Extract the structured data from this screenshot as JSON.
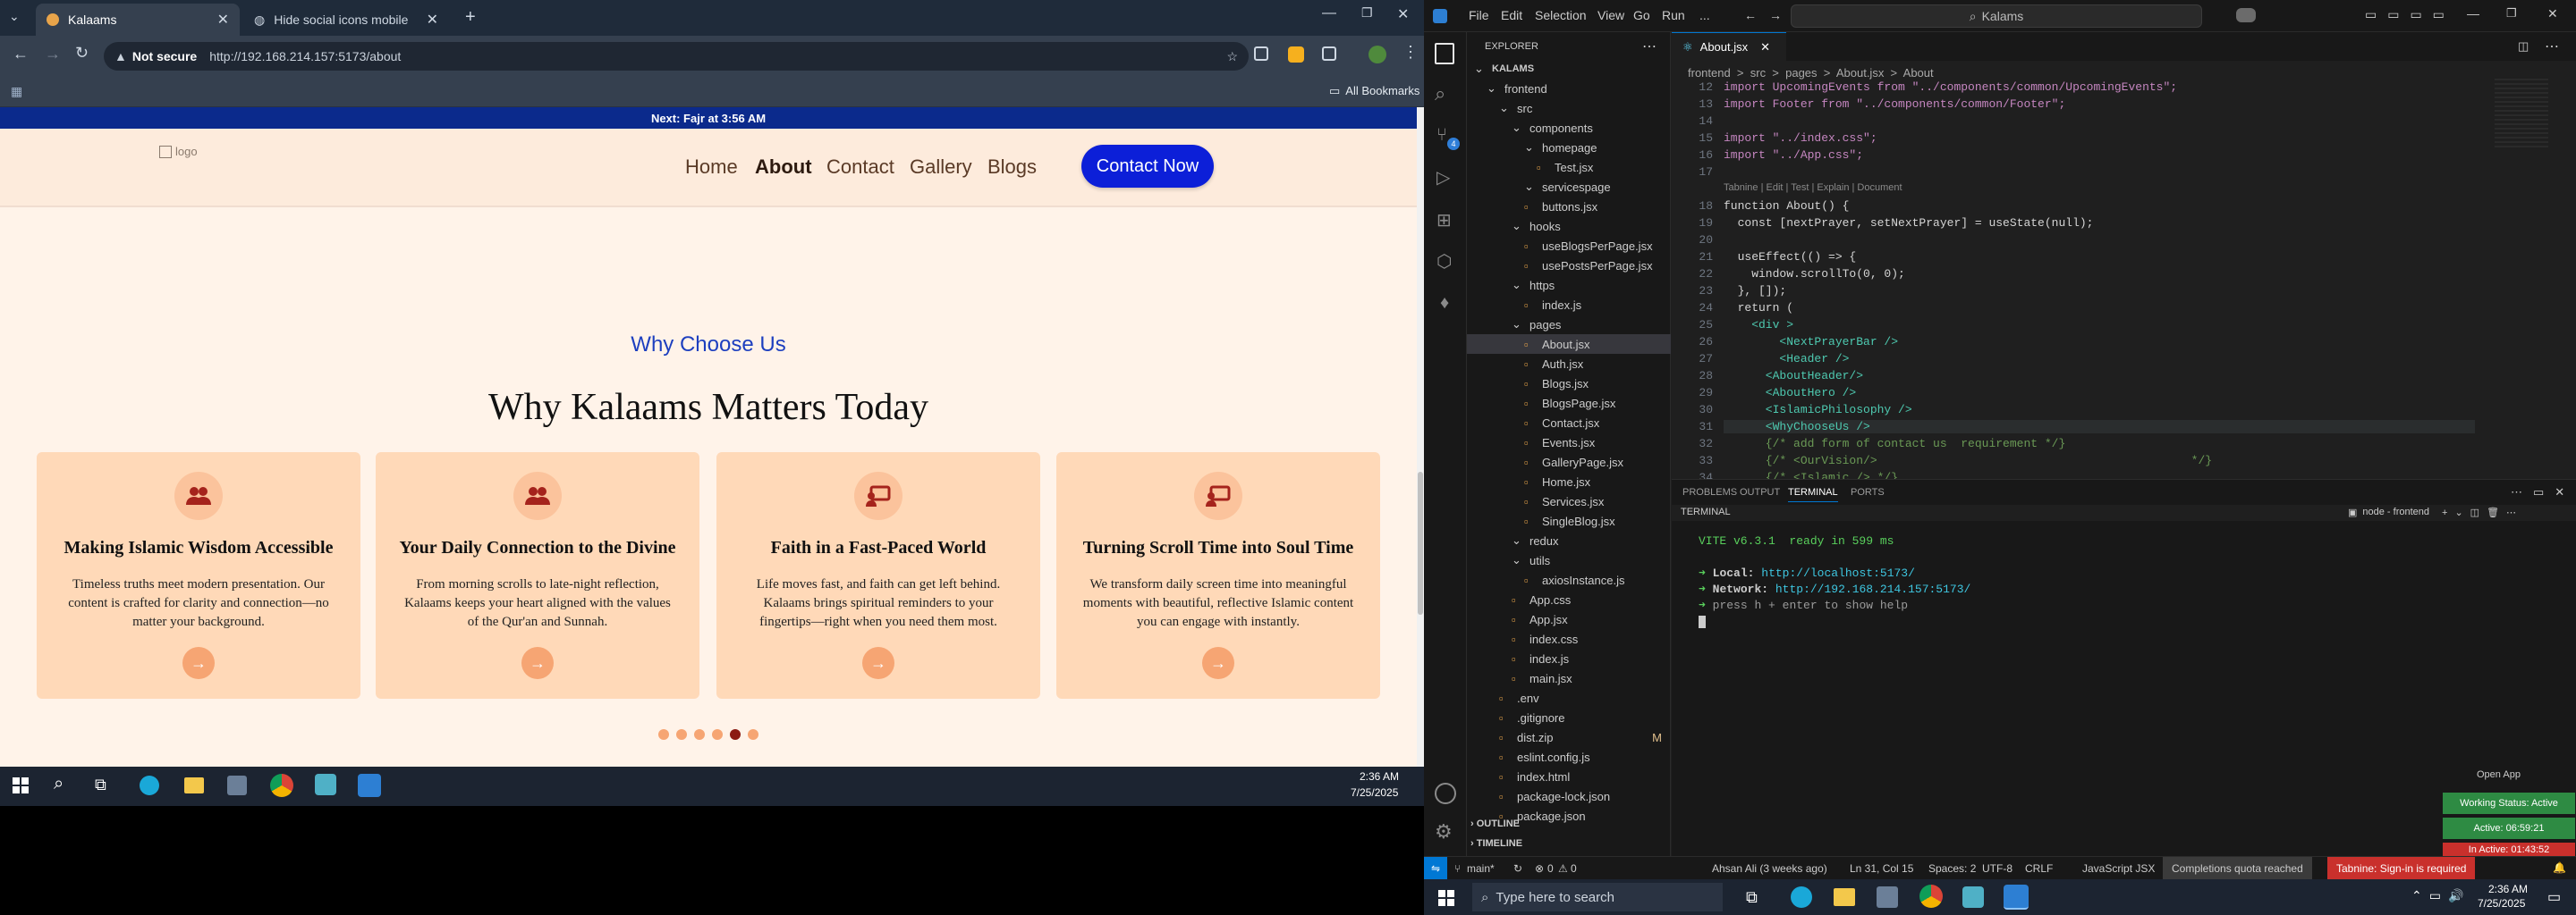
{
  "browser": {
    "tabs": [
      {
        "label": "Kalaams",
        "active": true
      },
      {
        "label": "Hide social icons mobile",
        "active": false
      }
    ],
    "security_label": "Not secure",
    "url": "http://192.168.214.157:5173/about",
    "all_bookmarks": "All Bookmarks"
  },
  "site": {
    "prayer_bar": "Next: Fajr at 3:56 AM",
    "logo_alt": "logo",
    "nav": [
      "Home",
      "About",
      "Contact",
      "Gallery",
      "Blogs"
    ],
    "contact_button": "Contact Now",
    "section_kicker": "Why Choose Us",
    "section_title": "Why Kalaams Matters Today",
    "cards": [
      {
        "title": "Making Islamic Wisdom Accessible",
        "text": "Timeless truths meet modern presentation. Our content is crafted for clarity and connection—no matter your background.",
        "icon": "users-icon"
      },
      {
        "title": "Your Daily Connection to the Divine",
        "text": "From morning scrolls to late-night reflection, Kalaams keeps your heart aligned with the values of the Qur'an and Sunnah.",
        "icon": "users-icon"
      },
      {
        "title": "Faith in a Fast-Paced World",
        "text": "Life moves fast, and faith can get left behind. Kalaams brings spiritual reminders to your fingertips—right when you need them most.",
        "icon": "presentation-icon"
      },
      {
        "title": "Turning Scroll Time into Soul Time",
        "text": "We transform daily screen time into meaningful moments with beautiful, reflective Islamic content you can engage with instantly.",
        "icon": "presentation-icon"
      }
    ],
    "carousel_dots": 6,
    "carousel_active": 4,
    "accent": "#0c1fd8",
    "card_bg": "#ffd9b8"
  },
  "taskbar_left": {
    "time": "2:36 AM",
    "date": "7/25/2025"
  },
  "vscode": {
    "menu": [
      "File",
      "Edit",
      "Selection",
      "View",
      "Go",
      "Run",
      "..."
    ],
    "search": "Kalams",
    "editor_tab": "About.jsx",
    "explorer_title": "EXPLORER",
    "breadcrumb": "frontend  >  src  >  pages  >  About.jsx  >  About",
    "explorer": [
      {
        "label": "KALAMS",
        "indent": 0,
        "kind": "root"
      },
      {
        "label": "frontend",
        "indent": 1,
        "kind": "folder"
      },
      {
        "label": "src",
        "indent": 2,
        "kind": "folder"
      },
      {
        "label": "components",
        "indent": 3,
        "kind": "folder"
      },
      {
        "label": "homepage",
        "indent": 4,
        "kind": "folder"
      },
      {
        "label": "Test.jsx",
        "indent": 5,
        "kind": "file"
      },
      {
        "label": "servicespage",
        "indent": 4,
        "kind": "folder"
      },
      {
        "label": "buttons.jsx",
        "indent": 4,
        "kind": "file"
      },
      {
        "label": "hooks",
        "indent": 3,
        "kind": "folder"
      },
      {
        "label": "useBlogsPerPage.jsx",
        "indent": 4,
        "kind": "file"
      },
      {
        "label": "usePostsPerPage.jsx",
        "indent": 4,
        "kind": "file"
      },
      {
        "label": "https",
        "indent": 3,
        "kind": "folder"
      },
      {
        "label": "index.js",
        "indent": 4,
        "kind": "file"
      },
      {
        "label": "pages",
        "indent": 3,
        "kind": "folder"
      },
      {
        "label": "About.jsx",
        "indent": 4,
        "kind": "file",
        "selected": true
      },
      {
        "label": "Auth.jsx",
        "indent": 4,
        "kind": "file"
      },
      {
        "label": "Blogs.jsx",
        "indent": 4,
        "kind": "file"
      },
      {
        "label": "BlogsPage.jsx",
        "indent": 4,
        "kind": "file"
      },
      {
        "label": "Contact.jsx",
        "indent": 4,
        "kind": "file"
      },
      {
        "label": "Events.jsx",
        "indent": 4,
        "kind": "file"
      },
      {
        "label": "GalleryPage.jsx",
        "indent": 4,
        "kind": "file"
      },
      {
        "label": "Home.jsx",
        "indent": 4,
        "kind": "file"
      },
      {
        "label": "Services.jsx",
        "indent": 4,
        "kind": "file"
      },
      {
        "label": "SingleBlog.jsx",
        "indent": 4,
        "kind": "file"
      },
      {
        "label": "redux",
        "indent": 3,
        "kind": "folder"
      },
      {
        "label": "utils",
        "indent": 3,
        "kind": "folder"
      },
      {
        "label": "axiosInstance.js",
        "indent": 4,
        "kind": "file"
      },
      {
        "label": "App.css",
        "indent": 3,
        "kind": "file"
      },
      {
        "label": "App.jsx",
        "indent": 3,
        "kind": "file"
      },
      {
        "label": "index.css",
        "indent": 3,
        "kind": "file"
      },
      {
        "label": "index.js",
        "indent": 3,
        "kind": "file"
      },
      {
        "label": "main.jsx",
        "indent": 3,
        "kind": "file"
      },
      {
        "label": ".env",
        "indent": 2,
        "kind": "file"
      },
      {
        "label": ".gitignore",
        "indent": 2,
        "kind": "file"
      },
      {
        "label": "dist.zip",
        "indent": 2,
        "kind": "file",
        "badge": "M"
      },
      {
        "label": "eslint.config.js",
        "indent": 2,
        "kind": "file"
      },
      {
        "label": "index.html",
        "indent": 2,
        "kind": "file"
      },
      {
        "label": "package-lock.json",
        "indent": 2,
        "kind": "file"
      },
      {
        "label": "package.json",
        "indent": 2,
        "kind": "file"
      }
    ],
    "outline": "OUTLINE",
    "timeline": "TIMELINE",
    "code": [
      {
        "n": "12",
        "t": "import UpcomingEvents from \"../components/common/UpcomingEvents\";"
      },
      {
        "n": "13",
        "t": "import Footer from \"../components/common/Footer\";"
      },
      {
        "n": "14",
        "t": ""
      },
      {
        "n": "15",
        "t": "import \"../index.css\";"
      },
      {
        "n": "16",
        "t": "import \"../App.css\";"
      },
      {
        "n": "17",
        "t": ""
      },
      {
        "n": "",
        "t": "Tabnine | Edit | Test | Explain | Document"
      },
      {
        "n": "18",
        "t": "function About() {"
      },
      {
        "n": "19",
        "t": "  const [nextPrayer, setNextPrayer] = useState(null);"
      },
      {
        "n": "20",
        "t": ""
      },
      {
        "n": "21",
        "t": "  useEffect(() => {"
      },
      {
        "n": "22",
        "t": "    window.scrollTo(0, 0);"
      },
      {
        "n": "23",
        "t": "  }, []);"
      },
      {
        "n": "24",
        "t": "  return ("
      },
      {
        "n": "25",
        "t": "    <div >"
      },
      {
        "n": "26",
        "t": "        <NextPrayerBar />"
      },
      {
        "n": "27",
        "t": "        <Header />"
      },
      {
        "n": "28",
        "t": "      <AboutHeader/>"
      },
      {
        "n": "29",
        "t": "      <AboutHero />"
      },
      {
        "n": "30",
        "t": "      <IslamicPhilosophy />"
      },
      {
        "n": "31",
        "t": "      <WhyChooseUs />"
      },
      {
        "n": "32",
        "t": "      {/* add form of contact us  requirement */}"
      },
      {
        "n": "33",
        "t": "      {/* <OurVision/>                                             */}"
      },
      {
        "n": "34",
        "t": "      {/* <Islamic /> */}"
      }
    ],
    "panel_tabs": [
      "PROBLEMS",
      "OUTPUT",
      "TERMINAL",
      "PORTS"
    ],
    "terminal_label": "TERMINAL",
    "terminal_instance": "node - frontend",
    "terminal": {
      "vite": "VITE v6.3.1  ready in 599 ms",
      "local_label": "Local:",
      "local_url": "http://localhost:5173/",
      "network_label": "Network:",
      "network_url": "http://192.168.214.157:5173/",
      "help": "press h + enter to show help"
    },
    "status": {
      "branch": "main*",
      "errors": "0",
      "warnings": "0",
      "author": "Ahsan Ali (3 weeks ago)",
      "position": "Ln 31, Col 15",
      "spaces": "Spaces: 2",
      "encoding": "UTF-8",
      "eol": "CRLF",
      "language": "JavaScript JSX",
      "quota": "Completions quota reached",
      "tabnine": "Tabnine: Sign-in is required"
    },
    "wakatime": {
      "open_app": "Open App",
      "working": "Working Status: Active",
      "active": "Active: 06:59:21",
      "inactive": "In Active: 01:43:52"
    }
  },
  "taskbar_right": {
    "search_placeholder": "Type here to search",
    "time": "2:36 AM",
    "date": "7/25/2025"
  }
}
